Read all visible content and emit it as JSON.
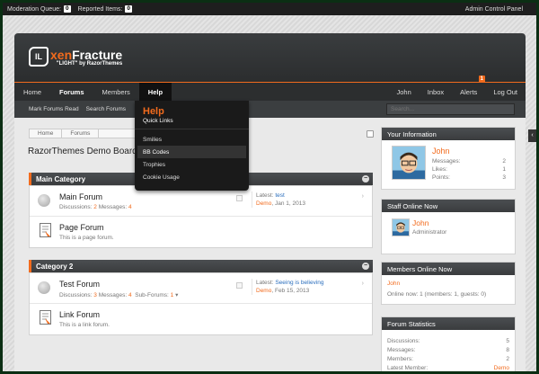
{
  "modbar": {
    "moderation_label": "Moderation Queue:",
    "moderation_count": "0",
    "reported_label": "Reported Items:",
    "reported_count": "0",
    "admin_link": "Admin Control Panel"
  },
  "logo": {
    "mark": "IL",
    "xen": "xen",
    "fracture": "Fracture",
    "tagline": "\"LIGHT\" by RazorThemes"
  },
  "nav": {
    "tabs": [
      "Home",
      "Forums",
      "Members",
      "Help"
    ],
    "right": [
      "John",
      "Inbox",
      "Alerts",
      "Log Out"
    ],
    "alerts_count": "1"
  },
  "subnav": {
    "links": [
      "Mark Forums Read",
      "Search Forums"
    ],
    "search_placeholder": "Search..."
  },
  "help_menu": {
    "title": "Help",
    "quick_links": "Quick Links",
    "items": [
      "Smilies",
      "BB Codes",
      "Trophies",
      "Cookie Usage"
    ]
  },
  "breadcrumb": [
    "Home",
    "Forums"
  ],
  "board_title": "RazorThemes Demo Board",
  "categories": [
    {
      "name": "Main Category",
      "forums": [
        {
          "name": "Main Forum",
          "disc_label": "Discussions:",
          "disc": "2",
          "msg_label": "Messages:",
          "msg": "4",
          "latest_label": "Latest:",
          "latest_title": "test",
          "latest_user": "Demo",
          "latest_date": "Jan 1, 2013"
        },
        {
          "name": "Page Forum",
          "desc": "This is a page forum."
        }
      ]
    },
    {
      "name": "Category 2",
      "forums": [
        {
          "name": "Test Forum",
          "disc_label": "Discussions:",
          "disc": "3",
          "msg_label": "Messages:",
          "msg": "4",
          "sub_label": "Sub-Forums:",
          "sub": "1",
          "latest_label": "Latest:",
          "latest_title": "Seeing is believing",
          "latest_user": "Demo",
          "latest_date": "Feb 15, 2013"
        },
        {
          "name": "Link Forum",
          "desc": "This is a link forum."
        }
      ]
    }
  ],
  "sidebar": {
    "your_info": {
      "title": "Your Information",
      "name": "John",
      "stats": [
        {
          "label": "Messages:",
          "value": "2"
        },
        {
          "label": "Likes:",
          "value": "1"
        },
        {
          "label": "Points:",
          "value": "3"
        }
      ]
    },
    "staff_online": {
      "title": "Staff Online Now",
      "name": "John",
      "role": "Administrator"
    },
    "members_online": {
      "title": "Members Online Now",
      "name": "John",
      "count": "Online now: 1 (members: 1, guests: 0)"
    },
    "forum_stats": {
      "title": "Forum Statistics",
      "stats": [
        {
          "label": "Discussions:",
          "value": "5"
        },
        {
          "label": "Messages:",
          "value": "8"
        },
        {
          "label": "Members:",
          "value": "2"
        },
        {
          "label": "Latest Member:",
          "value": "Demo"
        }
      ]
    }
  },
  "colors": {
    "accent": "#f26b1d",
    "dark": "#2c2e2f",
    "link": "#2a6ebd"
  }
}
